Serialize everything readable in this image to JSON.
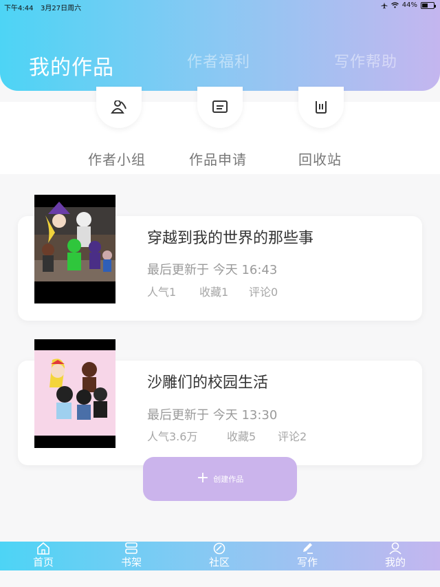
{
  "status_bar": {
    "time": "下午4:44",
    "date": "3月27日周六",
    "battery": "44%"
  },
  "tabs": [
    {
      "label": "我的作品",
      "active": true
    },
    {
      "label": "作者福利",
      "active": false
    },
    {
      "label": "写作帮助",
      "active": false
    }
  ],
  "quick_actions": [
    {
      "label": "作者小组",
      "icon": "group-icon"
    },
    {
      "label": "作品申请",
      "icon": "application-icon"
    },
    {
      "label": "回收站",
      "icon": "trash-icon"
    }
  ],
  "works": [
    {
      "title": "穿越到我的世界的那些事",
      "update": "最后更新于 今天 16:43",
      "popularity": "人气1",
      "favorites": "收藏1",
      "comments": "评论0"
    },
    {
      "title": "沙雕们的校园生活",
      "update": "最后更新于 今天 13:30",
      "popularity": "人气3.6万",
      "favorites": "收藏5",
      "comments": "评论2"
    }
  ],
  "create_button": {
    "label": "创建作品",
    "icon": "plus-icon"
  },
  "bottom_nav": [
    {
      "label": "首页",
      "icon": "home-icon"
    },
    {
      "label": "书架",
      "icon": "bookshelf-icon"
    },
    {
      "label": "社区",
      "icon": "community-icon"
    },
    {
      "label": "写作",
      "icon": "write-icon",
      "active": true
    },
    {
      "label": "我的",
      "icon": "profile-icon"
    }
  ],
  "colors": {
    "gradient_start": "#4dd4f5",
    "gradient_end": "#c4b6ef",
    "create_button": "#cbb4ec"
  }
}
